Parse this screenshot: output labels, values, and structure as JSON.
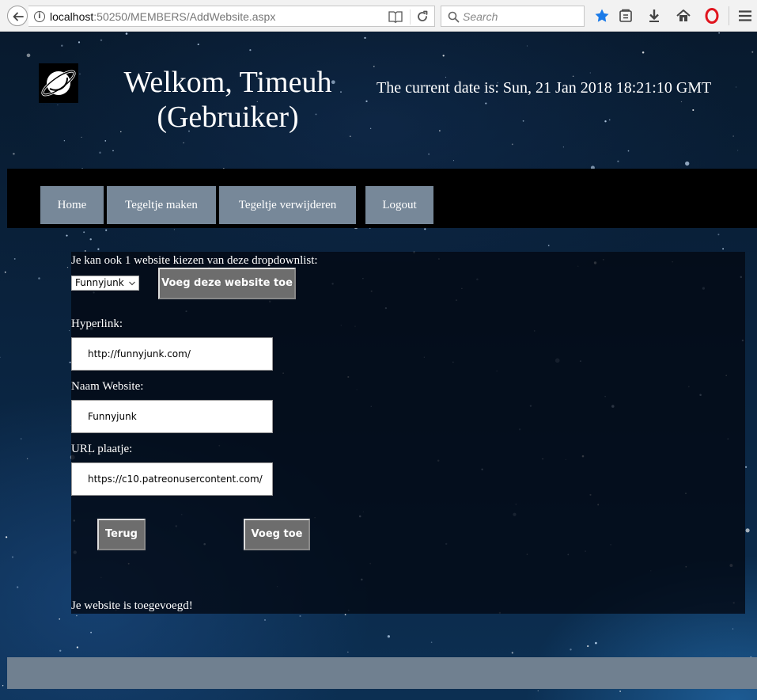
{
  "browser": {
    "url_host": "localhost",
    "url_rest": ":50250/MEMBERS/AddWebsite.aspx",
    "search_placeholder": "Search"
  },
  "header": {
    "welcome_line1": "Welkom, Timeuh",
    "welcome_line2": "(Gebruiker)",
    "date": "The current date is: Sun, 21 Jan 2018 18:21:10 GMT"
  },
  "nav": {
    "home": "Home",
    "tile_make": "Tegeltje maken",
    "tile_remove": "Tegeltje verwijderen",
    "logout": "Logout"
  },
  "form": {
    "dropdown_label": "Je kan ook 1 website kiezen van deze dropdownlist:",
    "dropdown_selected": "Funnyjunk",
    "add_site_button": "Voeg deze website toe",
    "hyperlink_label": "Hyperlink:",
    "hyperlink_value": "http://funnyjunk.com/",
    "name_label": "Naam Website:",
    "name_value": "Funnyjunk",
    "image_label": "URL plaatje:",
    "image_value": "https://c10.patreonusercontent.com/",
    "back_button": "Terug",
    "add_button": "Voeg toe",
    "status": "Je website is toegevoegd!"
  },
  "colors": {
    "nav_button": "#778899",
    "footer": "#708090",
    "button": "#6d6d6d",
    "star_icon": "#1a7ae8",
    "opera_icon": "#e0141e"
  },
  "icons": [
    "back-arrow-icon",
    "info-icon",
    "reader-view-icon",
    "reload-icon",
    "search-icon",
    "bookmark-star-icon",
    "library-icon",
    "download-icon",
    "home-icon",
    "opera-icon",
    "menu-icon",
    "planet-logo-icon",
    "chevron-down-icon"
  ]
}
